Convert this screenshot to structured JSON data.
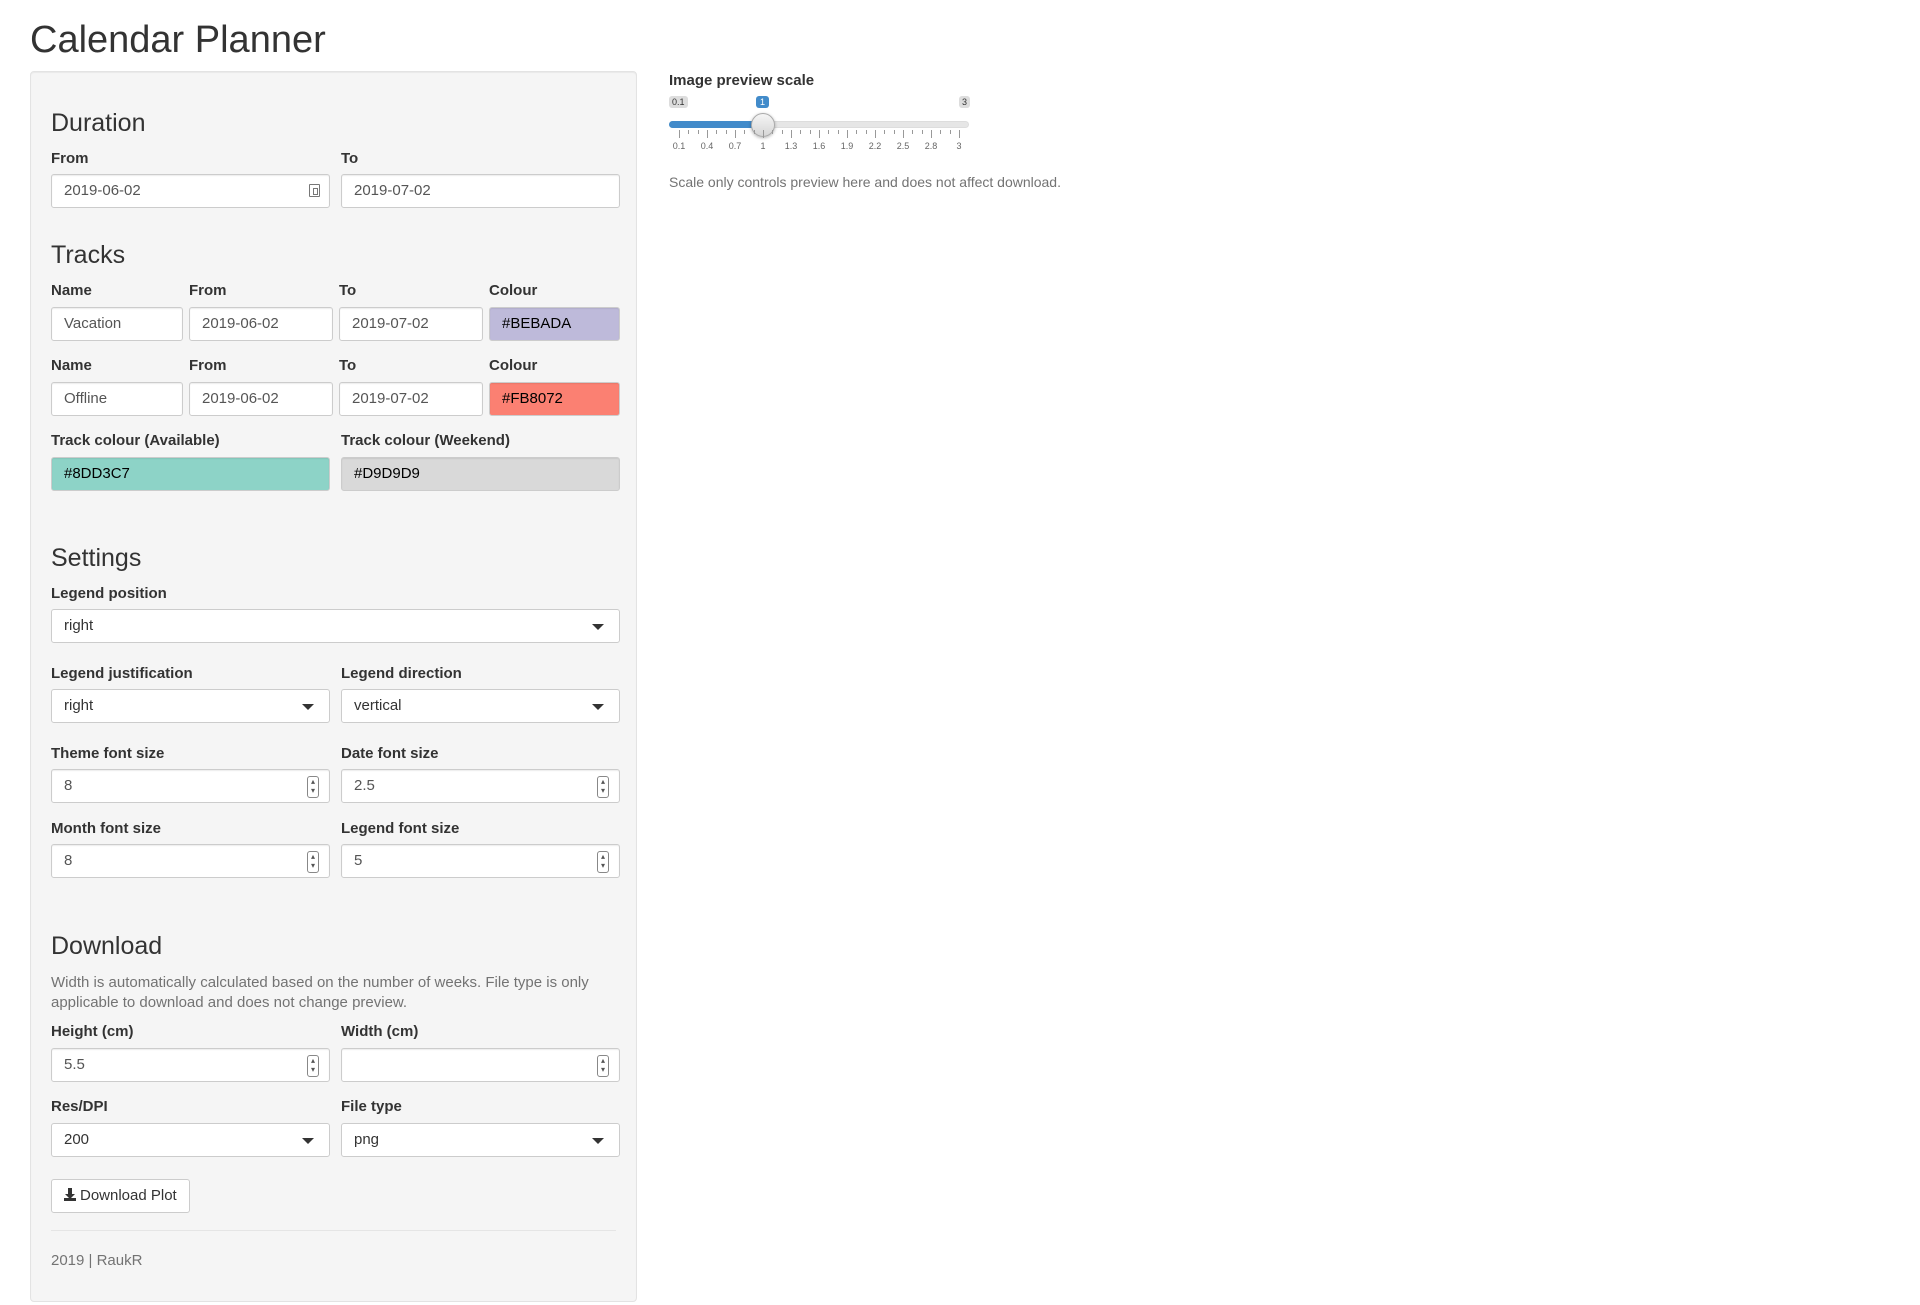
{
  "page_title": "Calendar Planner",
  "duration": {
    "heading": "Duration",
    "from_label": "From",
    "from_value": "2019-06-02",
    "to_label": "To",
    "to_value": "2019-07-02"
  },
  "tracks": {
    "heading": "Tracks",
    "rows": [
      {
        "name_label": "Name",
        "name_value": "Vacation",
        "from_label": "From",
        "from_value": "2019-06-02",
        "to_label": "To",
        "to_value": "2019-07-02",
        "colour_label": "Colour",
        "colour_value": "#BEBADA",
        "colour_hex": "#BEBADA"
      },
      {
        "name_label": "Name",
        "name_value": "Offline",
        "from_label": "From",
        "from_value": "2019-06-02",
        "to_label": "To",
        "to_value": "2019-07-02",
        "colour_label": "Colour",
        "colour_value": "#FB8072",
        "colour_hex": "#FB8072"
      }
    ],
    "available_label": "Track colour (Available)",
    "available_value": "#8DD3C7",
    "available_hex": "#8DD3C7",
    "weekend_label": "Track colour (Weekend)",
    "weekend_value": "#D9D9D9",
    "weekend_hex": "#D9D9D9"
  },
  "settings": {
    "heading": "Settings",
    "legend_position_label": "Legend position",
    "legend_position_value": "right",
    "legend_justification_label": "Legend justification",
    "legend_justification_value": "right",
    "legend_direction_label": "Legend direction",
    "legend_direction_value": "vertical",
    "theme_font_size_label": "Theme font size",
    "theme_font_size_value": "8",
    "date_font_size_label": "Date font size",
    "date_font_size_value": "2.5",
    "month_font_size_label": "Month font size",
    "month_font_size_value": "8",
    "legend_font_size_label": "Legend font size",
    "legend_font_size_value": "5"
  },
  "download": {
    "heading": "Download",
    "help": "Width is automatically calculated based on the number of weeks. File type is only applicable to download and does not change preview.",
    "height_label": "Height (cm)",
    "height_value": "5.5",
    "width_label": "Width (cm)",
    "width_value": "",
    "res_label": "Res/DPI",
    "res_value": "200",
    "filetype_label": "File type",
    "filetype_value": "png",
    "button_label": "Download Plot"
  },
  "footer": "2019 | RaukR",
  "preview": {
    "label": "Image preview scale",
    "min": "0.1",
    "max": "3",
    "value": "1",
    "value_fraction": 0.31,
    "ticks": [
      "0.1",
      "0.4",
      "0.7",
      "1",
      "1.3",
      "1.6",
      "1.9",
      "2.2",
      "2.5",
      "2.8",
      "3"
    ],
    "note": "Scale only controls preview here and does not affect download."
  }
}
